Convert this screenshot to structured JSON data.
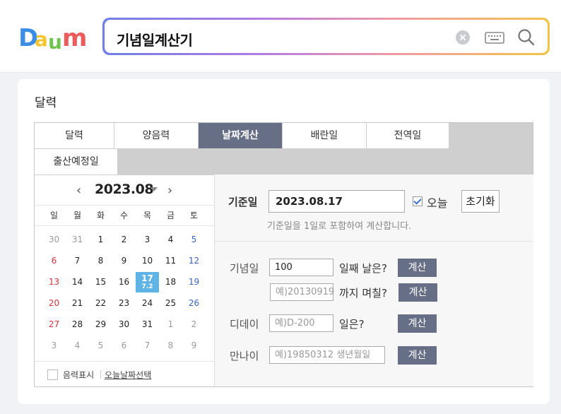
{
  "search": {
    "query": "기념일계산기"
  },
  "card": {
    "title": "달력"
  },
  "tabs": [
    {
      "label": "달력"
    },
    {
      "label": "양음력"
    },
    {
      "label": "날짜계산"
    },
    {
      "label": "배란일"
    },
    {
      "label": "전역일"
    },
    {
      "label": "출산예정일"
    }
  ],
  "calendar": {
    "month_title": "2023.08",
    "weekdays": [
      "일",
      "월",
      "화",
      "수",
      "목",
      "금",
      "토"
    ],
    "weeks": [
      [
        "30",
        "31",
        "1",
        "2",
        "3",
        "4",
        "5"
      ],
      [
        "6",
        "7",
        "8",
        "9",
        "10",
        "11",
        "12"
      ],
      [
        "13",
        "14",
        "15",
        "16",
        "17",
        "18",
        "19"
      ],
      [
        "20",
        "21",
        "22",
        "23",
        "24",
        "25",
        "26"
      ],
      [
        "27",
        "28",
        "29",
        "30",
        "31",
        "1",
        "2"
      ],
      [
        "3",
        "4",
        "5",
        "6",
        "7",
        "8",
        "9"
      ]
    ],
    "selected_lunar": "7.2",
    "lunar_toggle_label": "음력표시",
    "today_link_label": "오늘날짜선택"
  },
  "calc": {
    "base_label": "기준일",
    "base_value": "2023.08.17",
    "today_label": "오늘",
    "reset_label": "초기화",
    "hint": "기준일을 1일로 포함하여 계산합니다.",
    "anniv_label": "기념일",
    "anniv_value": "100",
    "anniv_suffix": "일째 날은?",
    "until_placeholder": "예)20130919",
    "until_suffix": "까지 며칠?",
    "dday_label": "디데이",
    "dday_placeholder": "예)D-200",
    "dday_suffix": "일은?",
    "age_label": "만나이",
    "age_placeholder": "예)19850312  생년월일",
    "calc_button": "계산"
  }
}
